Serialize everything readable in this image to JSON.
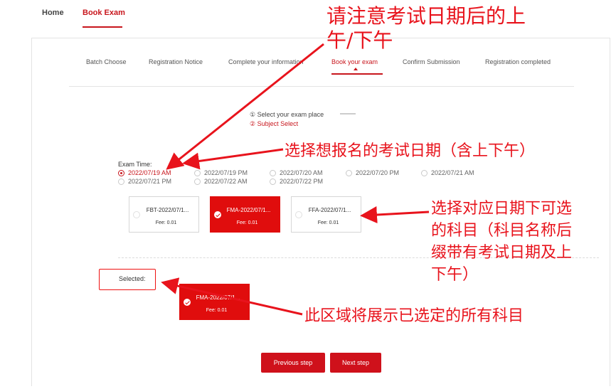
{
  "nav": {
    "home": "Home",
    "book_exam": "Book Exam"
  },
  "steps": [
    {
      "label": "Batch Choose"
    },
    {
      "label": "Registration Notice"
    },
    {
      "label": "Complete your information"
    },
    {
      "label": "Book your exam"
    },
    {
      "label": "Confirm Submission"
    },
    {
      "label": "Registration completed"
    }
  ],
  "substeps": {
    "place": "① Select your exam place",
    "subject": "② Subject Select"
  },
  "exam_time": {
    "label": "Exam Time:",
    "options": [
      "2022/07/19 AM",
      "2022/07/19 PM",
      "2022/07/20 AM",
      "2022/07/20 PM",
      "2022/07/21 AM",
      "2022/07/21 PM",
      "2022/07/22 AM",
      "2022/07/22 PM"
    ],
    "selected_index": 0
  },
  "subjects": [
    {
      "name": "FBT-2022/07/1...",
      "fee": "Fee: 0.01",
      "selected": false
    },
    {
      "name": "FMA-2022/07/1...",
      "fee": "Fee: 0.01",
      "selected": true
    },
    {
      "name": "FFA-2022/07/1...",
      "fee": "Fee: 0.01",
      "selected": false
    }
  ],
  "selected_section": {
    "label": "Selected:",
    "items": [
      {
        "name": "FMA-2022/07/1...",
        "fee": "Fee: 0.01"
      }
    ]
  },
  "buttons": {
    "previous": "Previous step",
    "next": "Next step"
  },
  "annotations": {
    "a1_line1": "请注意考试日期后的上",
    "a1_line2": "午/下午",
    "a2": "选择想报名的考试日期（含上下午）",
    "a3_line1": "选择对应日期下可选",
    "a3_line2": "的科目（科目名称后",
    "a3_line3": "缀带有考试日期及上",
    "a3_line4": "下午）",
    "a4": "此区域将展示已选定的所有科目"
  },
  "colors": {
    "accent": "#c8161d",
    "subject_selected": "#e00d0d",
    "annotation": "#e8131c"
  }
}
